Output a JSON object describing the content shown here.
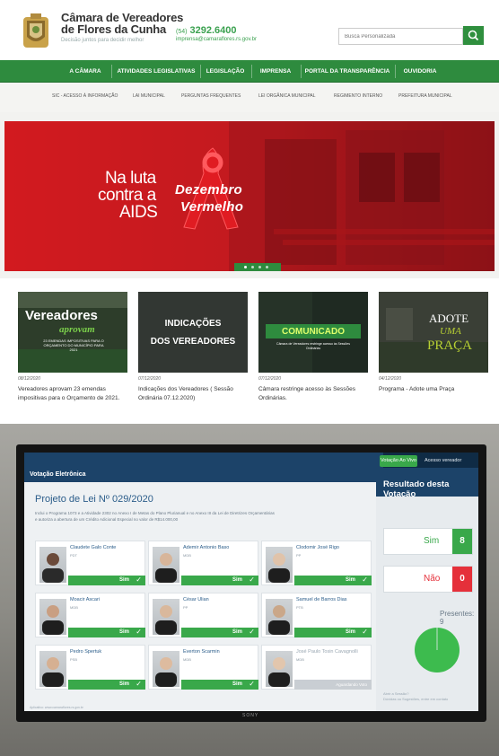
{
  "header": {
    "org_line1": "Câmara de Vereadores",
    "org_line2": "de Flores da Cunha",
    "slogan": "Decisão juntos para decidir melhor",
    "phone_ddd": "(54)",
    "phone_number": "3292.6400",
    "email": "imprensa@camaraflores.rs.gov.br",
    "search_placeholder": "Busca Personalizada",
    "colors": {
      "brand_green": "#2e8b3e",
      "button_green": "#2f8f3e"
    }
  },
  "nav": {
    "items": [
      {
        "label": "A CÂMARA"
      },
      {
        "label": "ATIVIDADES LEGISLATIVAS"
      },
      {
        "label": "LEGISLAÇÃO"
      },
      {
        "label": "IMPRENSA"
      },
      {
        "label": "PORTAL DA TRANSPARÊNCIA"
      },
      {
        "label": "OUVIDORIA"
      }
    ]
  },
  "subnav": {
    "items": [
      {
        "label": "SIC - ACESSO À INFORMAÇÃO"
      },
      {
        "label": "LAI MUNICIPAL"
      },
      {
        "label": "PERGUNTAS FREQUENTES"
      },
      {
        "label": "LEI ORGÂNICA MUNICIPAL"
      },
      {
        "label": "REGIMENTO INTERNO"
      },
      {
        "label": "PREFEITURA MUNICIPAL"
      }
    ]
  },
  "banner": {
    "line1": "Na luta",
    "line2": "contra a",
    "line3": "AIDS",
    "campaign1": "Dezembro",
    "campaign2": "Vermelho",
    "slide_count": 4,
    "active_slide": 1
  },
  "news": [
    {
      "img_line1": "Vereadores",
      "img_line2": "aprovam",
      "img_line3": "23 EMENDAS IMPOSITIVAS PARA O ORÇAMENTO DO MUNICÍPIO PARA 2021",
      "date": "08/12/2020",
      "title": "Vereadores aprovam 23 emendas impositivas para o Orçamento de 2021."
    },
    {
      "img_line1": "INDICAÇÕES",
      "img_line2": "DOS VEREADORES",
      "img_line3": "",
      "date": "07/12/2020",
      "title": "Indicações dos Vereadores ( Sessão Ordinária 07.12.2020)"
    },
    {
      "img_line1": "COMUNICADO",
      "img_line2": "Câmara de Vereadores restringe acesso às Sessões Ordinárias",
      "img_line3": "",
      "date": "07/12/2020",
      "title": "Câmara restringe acesso às Sessões Ordinárias."
    },
    {
      "img_line1": "ADOTE",
      "img_line2": "UMA",
      "img_line3": "PRAÇA",
      "date": "04/12/2020",
      "title": "Programa - Adote uma Praça"
    }
  ],
  "voting_screen": {
    "live_button": "Votação Ao Vivo",
    "access_button": "Acesso vereador",
    "title": "Votação Eletrônica",
    "result_title": "Resultado desta Votação",
    "project": "Projeto de Lei Nº 029/2020",
    "desc_line1": "Inclui o Programa 1073 e a Atividade 2302 no Anexo I de Metas do Plano Plurianual e no Anexo III da Lei de Diretrizes Orçamentárias",
    "desc_line2": "e autoriza a abertura de um Crédito Adicional Especial no valor de R$14.000,00",
    "vereadores": [
      {
        "name": "Claudete Galo Conte",
        "party": "PDT",
        "vote": "Sim"
      },
      {
        "name": "Ademir Antonio Baso",
        "party": "MDB",
        "vote": "Sim"
      },
      {
        "name": "Clodomir José Rigo",
        "party": "PP",
        "vote": "Sim"
      },
      {
        "name": "Moacir Ascari",
        "party": "MDB",
        "vote": "Sim"
      },
      {
        "name": "César Ulian",
        "party": "PP",
        "vote": "Sim"
      },
      {
        "name": "Samuel de Barros Dias",
        "party": "PTB",
        "vote": "Sim"
      },
      {
        "name": "Pedro Spertuk",
        "party": "PSB",
        "vote": "Sim"
      },
      {
        "name": "Everton Scarmin",
        "party": "MDB",
        "vote": "Sim"
      },
      {
        "name": "José Paulo Tosin Cavagnolli",
        "party": "MDB",
        "vote": "Aguardando Voto"
      }
    ],
    "sim_label": "Sim",
    "sim_count": "8",
    "nao_label": "Não",
    "nao_count": "0",
    "presentes": "Presentes: 9",
    "footer1": "Abrir a Sessão?",
    "footer2": "Dúvidas ou Sugestões, entre em contato",
    "footer_left": "Aplicativo: www.camaraflores.rs.gov.br",
    "tv_brand": "SONY",
    "pie_fraction_sim": 0.99
  }
}
